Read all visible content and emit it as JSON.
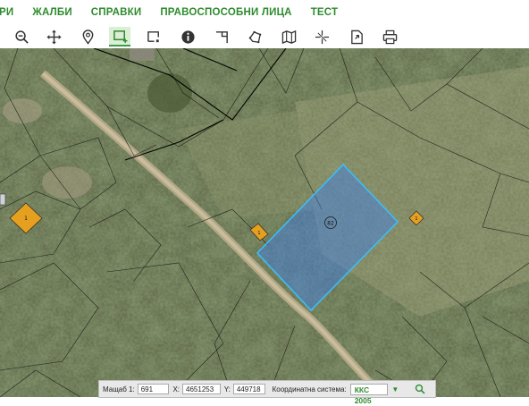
{
  "nav": {
    "items": [
      {
        "label": "РИ"
      },
      {
        "label": "ЖАЛБИ"
      },
      {
        "label": "СПРАВКИ"
      },
      {
        "label": "ПРАВОСПОСОБНИ ЛИЦА"
      },
      {
        "label": "ТЕСТ"
      }
    ]
  },
  "toolbar": {
    "tools": [
      {
        "icon": "zoom-out-icon"
      },
      {
        "icon": "pan-icon"
      },
      {
        "icon": "location-pin-icon"
      },
      {
        "icon": "select-rectangle-icon",
        "active": true
      },
      {
        "icon": "select-area-icon"
      },
      {
        "icon": "info-icon"
      },
      {
        "icon": "measure-distance-icon"
      },
      {
        "icon": "measure-area-icon"
      },
      {
        "icon": "layers-map-icon"
      },
      {
        "icon": "coordinates-icon"
      },
      {
        "icon": "export-icon"
      },
      {
        "icon": "print-icon"
      }
    ],
    "accent_color": "#2e8b2e"
  },
  "map": {
    "parcel_labels": [
      "1",
      "1",
      "1",
      "1",
      "82"
    ],
    "colors": {
      "selected_fill": "#3b7ff0",
      "selected_stroke": "#39c0ff",
      "building_fill": "#e6a020"
    }
  },
  "status": {
    "scale_label": "Мащаб 1:",
    "scale_value": "691",
    "x_label": "X:",
    "x_value": "4651253",
    "y_label": "Y:",
    "y_value": "449718",
    "system_label": "Координатна система:",
    "system_value": "ККС 2005"
  }
}
